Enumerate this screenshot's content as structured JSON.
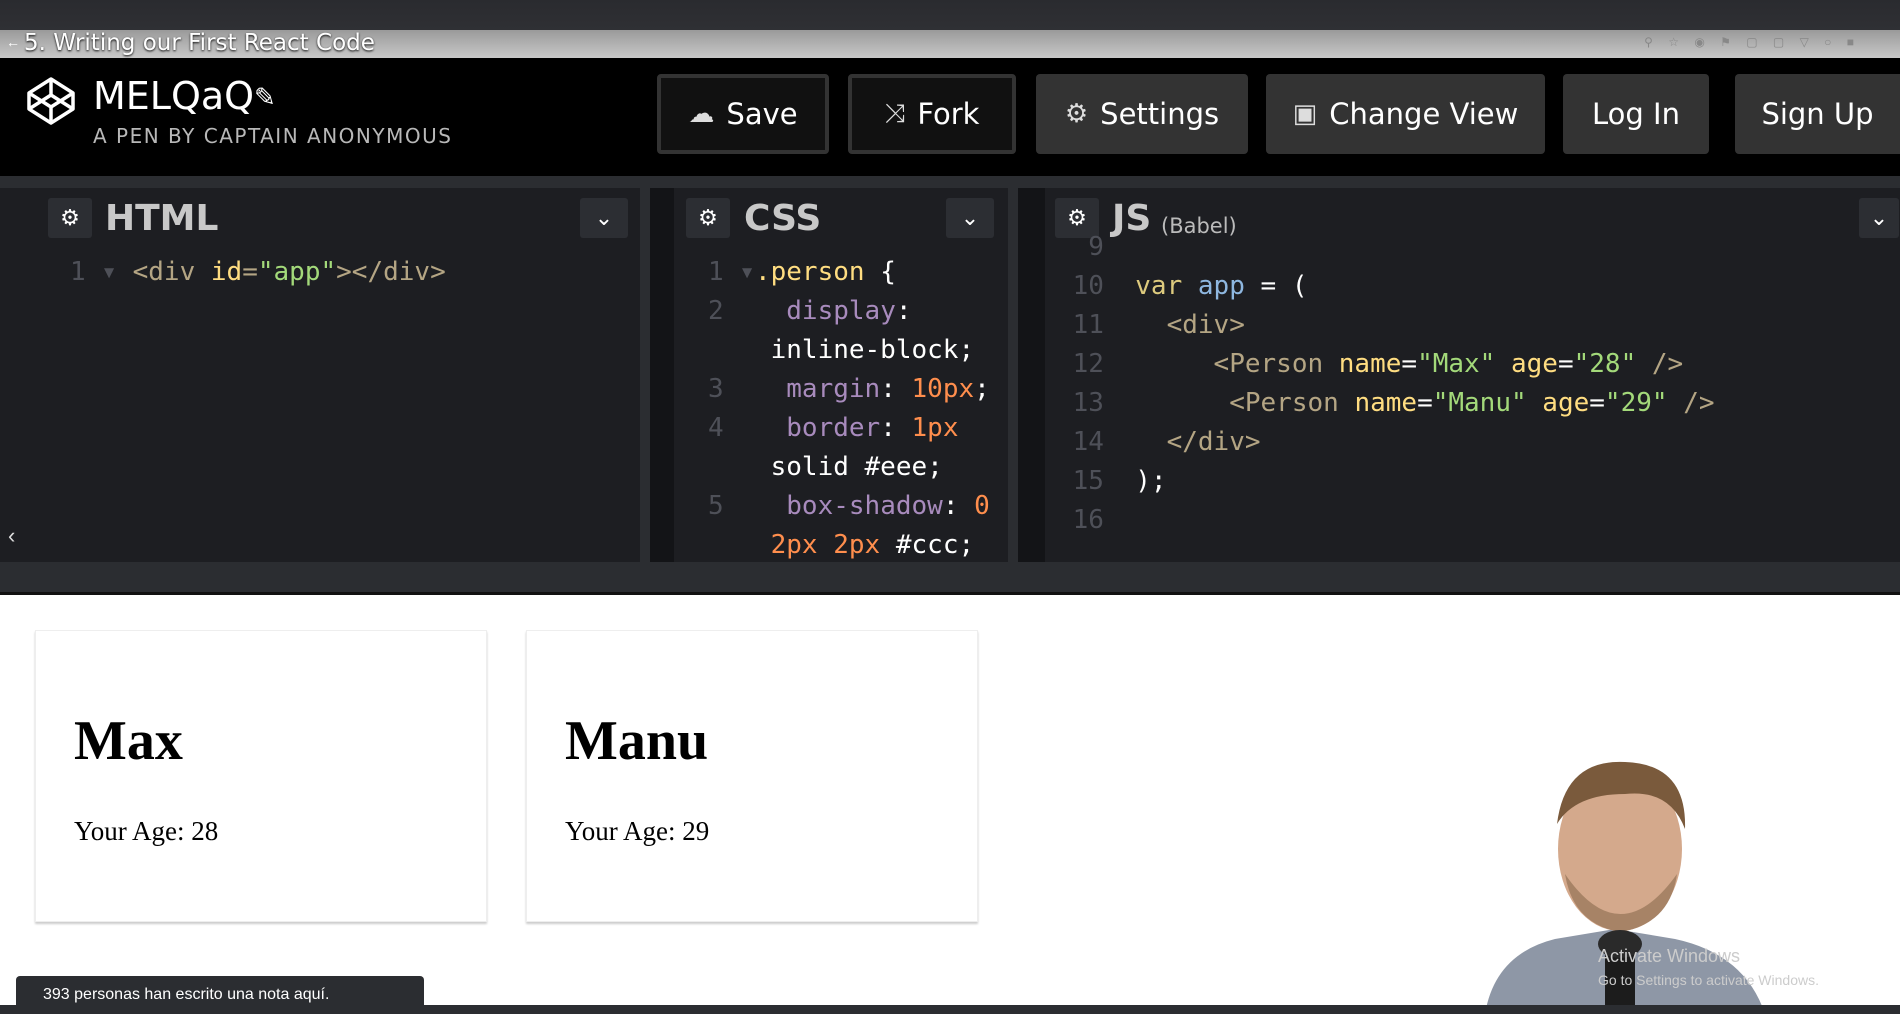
{
  "video": {
    "title": "5. Writing our First React Code"
  },
  "header": {
    "pen_title": "MELQaQ",
    "pen_by": "A PEN BY CAPTAIN ANONYMOUS",
    "buttons": {
      "save": "Save",
      "fork": "Fork",
      "settings": "Settings",
      "change_view": "Change View",
      "login": "Log In",
      "signup": "Sign Up"
    }
  },
  "editors": {
    "html": {
      "title": "HTML"
    },
    "css": {
      "title": "CSS"
    },
    "js": {
      "title": "JS",
      "subtitle": "(Babel)"
    }
  },
  "result": {
    "persons": [
      {
        "name": "Max",
        "age_text": "Your Age: 28"
      },
      {
        "name": "Manu",
        "age_text": "Your Age: 29"
      }
    ]
  },
  "notes": "393 personas han escrito una nota aquí.",
  "watermark": {
    "line1": "Activate Windows",
    "line2": "Go to Settings to activate Windows."
  },
  "colors": {
    "header_bg": "#000000",
    "editor_bg": "#1d1e22",
    "button_bg": "#333333"
  }
}
